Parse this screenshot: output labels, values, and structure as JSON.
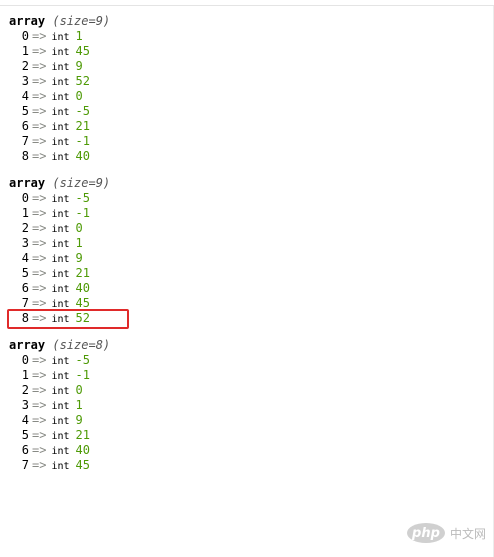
{
  "dumps": [
    {
      "keyword": "array",
      "size_label": "(size=9)",
      "items": [
        {
          "index": "0",
          "arrow": "=>",
          "type": "int",
          "value": "1"
        },
        {
          "index": "1",
          "arrow": "=>",
          "type": "int",
          "value": "45"
        },
        {
          "index": "2",
          "arrow": "=>",
          "type": "int",
          "value": "9"
        },
        {
          "index": "3",
          "arrow": "=>",
          "type": "int",
          "value": "52"
        },
        {
          "index": "4",
          "arrow": "=>",
          "type": "int",
          "value": "0"
        },
        {
          "index": "5",
          "arrow": "=>",
          "type": "int",
          "value": "-5"
        },
        {
          "index": "6",
          "arrow": "=>",
          "type": "int",
          "value": "21"
        },
        {
          "index": "7",
          "arrow": "=>",
          "type": "int",
          "value": "-1"
        },
        {
          "index": "8",
          "arrow": "=>",
          "type": "int",
          "value": "40"
        }
      ]
    },
    {
      "keyword": "array",
      "size_label": "(size=9)",
      "items": [
        {
          "index": "0",
          "arrow": "=>",
          "type": "int",
          "value": "-5"
        },
        {
          "index": "1",
          "arrow": "=>",
          "type": "int",
          "value": "-1"
        },
        {
          "index": "2",
          "arrow": "=>",
          "type": "int",
          "value": "0"
        },
        {
          "index": "3",
          "arrow": "=>",
          "type": "int",
          "value": "1"
        },
        {
          "index": "4",
          "arrow": "=>",
          "type": "int",
          "value": "9"
        },
        {
          "index": "5",
          "arrow": "=>",
          "type": "int",
          "value": "21"
        },
        {
          "index": "6",
          "arrow": "=>",
          "type": "int",
          "value": "40"
        },
        {
          "index": "7",
          "arrow": "=>",
          "type": "int",
          "value": "45"
        },
        {
          "index": "8",
          "arrow": "=>",
          "type": "int",
          "value": "52",
          "highlighted": true
        }
      ]
    },
    {
      "keyword": "array",
      "size_label": "(size=8)",
      "items": [
        {
          "index": "0",
          "arrow": "=>",
          "type": "int",
          "value": "-5"
        },
        {
          "index": "1",
          "arrow": "=>",
          "type": "int",
          "value": "-1"
        },
        {
          "index": "2",
          "arrow": "=>",
          "type": "int",
          "value": "0"
        },
        {
          "index": "3",
          "arrow": "=>",
          "type": "int",
          "value": "1"
        },
        {
          "index": "4",
          "arrow": "=>",
          "type": "int",
          "value": "9"
        },
        {
          "index": "5",
          "arrow": "=>",
          "type": "int",
          "value": "21"
        },
        {
          "index": "6",
          "arrow": "=>",
          "type": "int",
          "value": "40"
        },
        {
          "index": "7",
          "arrow": "=>",
          "type": "int",
          "value": "45"
        }
      ]
    }
  ],
  "highlight_color": "#e02a2a",
  "value_color": "#4e9a06",
  "arrow_color": "#888a85",
  "watermark": {
    "logo_text": "php",
    "site_text": "中文网"
  }
}
